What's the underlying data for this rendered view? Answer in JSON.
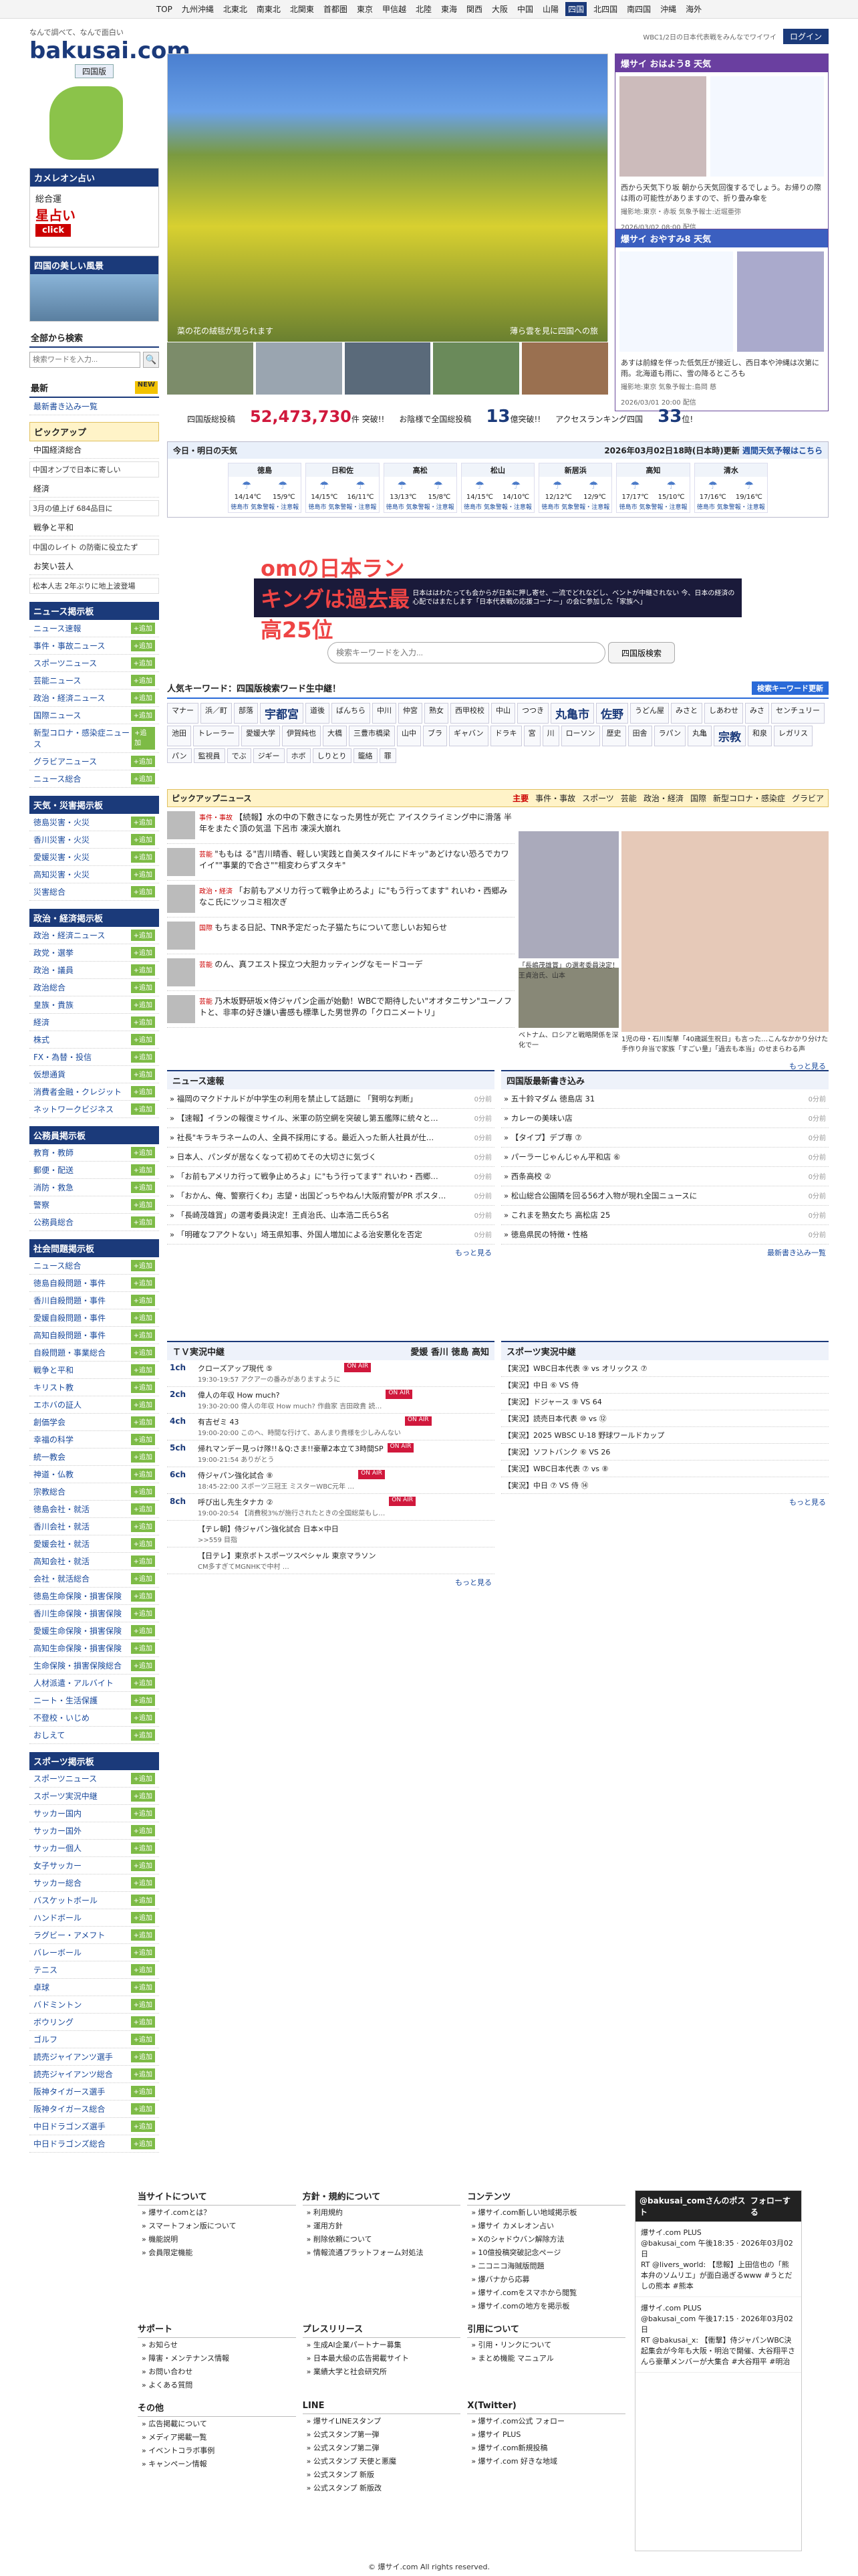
{
  "topnav": {
    "items": [
      "TOP",
      "九州沖縄",
      "北東北",
      "南東北",
      "北関東",
      "首都圏",
      "東京",
      "甲信越",
      "北陸",
      "東海",
      "関西",
      "大阪",
      "中国",
      "山陽",
      "四国",
      "北四国",
      "南四国",
      "沖縄",
      "海外"
    ],
    "active": "四国"
  },
  "header": {
    "tagline": "なんで調べて、なんで面白い",
    "logo": "bakusai.com",
    "region": "四国版",
    "login": "ログイン",
    "note": "WBC1/2日の日本代表戦をみんなでワイワイ"
  },
  "left": {
    "uranai_title": "カメレオン占い",
    "uranai_sub": "総合運",
    "uranai_star": "星占い",
    "uranai_click": "click",
    "scene_title": "四国の美しい風景",
    "search_title": "全部から検索",
    "search_placeholder": "検索ワードを入力...",
    "newest": "最新",
    "newest_link": "最新書き込み一覧",
    "pickup": "ピックアップ",
    "pickup_items": [
      "中国経済総合",
      "中国オンブで日本に寄しい",
      "経済",
      "3月の値上げ 684品目に",
      "戦争と平和",
      "中国のレイト の防衛に役立たず",
      "お笑い芸人",
      "松本人志 2年ぶりに地上波登場"
    ],
    "news_title": "ニュース掲示板",
    "news_items": [
      "ニュース速報",
      "事件・事故ニュース",
      "スポーツニュース",
      "芸能ニュース",
      "政治・経済ニュース",
      "国際ニュース",
      "新型コロナ・感染症ニュース",
      "グラビアニュース",
      "ニュース総合"
    ],
    "weather_title": "天気・災害掲示板",
    "weather_items": [
      "徳島災害・火災",
      "香川災害・火災",
      "愛媛災害・火災",
      "高知災害・火災",
      "災害総合"
    ],
    "politics_title": "政治・経済掲示板",
    "politics_items": [
      "政治・経済ニュース",
      "政党・選挙",
      "政治・議員",
      "政治総合",
      "皇族・貴族",
      "経済",
      "株式",
      "FX・為替・投信",
      "仮想通貨",
      "消費者金融・クレジット",
      "ネットワークビジネス"
    ],
    "public_title": "公務員掲示板",
    "public_items": [
      "教育・教師",
      "郵便・配送",
      "消防・救急",
      "警察",
      "公務員総合"
    ],
    "social_title": "社会問題掲示板",
    "social_items": [
      "ニュース総合",
      "徳島自殺問題・事件",
      "香川自殺問題・事件",
      "愛媛自殺問題・事件",
      "高知自殺問題・事件",
      "自殺問題・事業総合",
      "戦争と平和",
      "キリスト教",
      "エホバの証人",
      "創価学会",
      "幸福の科学",
      "統一教会",
      "神道・仏教",
      "宗教総合",
      "徳島会社・就活",
      "香川会社・就活",
      "愛媛会社・就活",
      "高知会社・就活",
      "会社・就活総合",
      "徳島生命保険・損害保険",
      "香川生命保険・損害保険",
      "愛媛生命保険・損害保険",
      "高知生命保険・損害保険",
      "生命保険・損害保険総合",
      "人材派遣・アルバイト",
      "ニート・生活保護",
      "不登校・いじめ",
      "おしえて"
    ],
    "sports_title": "スポーツ掲示板",
    "sports_items": [
      "スポーツニュース",
      "スポーツ実況中継",
      "サッカー国内",
      "サッカー国外",
      "サッカー個人",
      "女子サッカー",
      "サッカー総合",
      "バスケットボール",
      "ハンドボール",
      "ラグビー・アメフト",
      "バレーボール",
      "テニス",
      "卓球",
      "バドミントン",
      "ボウリング",
      "ゴルフ",
      "読売ジャイアンツ選手",
      "読売ジャイアンツ総合",
      "阪神タイガース選手",
      "阪神タイガース総合",
      "中日ドラゴンズ選手",
      "中日ドラゴンズ総合"
    ],
    "add": "+追加"
  },
  "hero": {
    "caption": "菜の花の絨毯が見られます",
    "caption2": "薄ら雲を見に四国への旅"
  },
  "stats": {
    "label1": "四国版総投稿",
    "posts": "52,473,730",
    "unit1": "件",
    "suffix1": "突破!!",
    "label2": "お陰様で全国総投稿",
    "posts2": "13",
    "unit2": "億突破!!",
    "label3": "アクセスランキング四国",
    "rank": "33",
    "unit3": "位!"
  },
  "weather_boxes": [
    {
      "title": "爆サイ おはよう8 天気",
      "text": "西から天気下り坂 朝から天気回復するでしょう。お帰りの際は雨の可能性がありますので、折り畳み傘を",
      "meta": "撮影地:東京・赤坂 気象予報士:近堀亜弥",
      "date": "2026/03/02 08:00 配信"
    },
    {
      "title": "爆サイ おやすみ8 天気",
      "text": "あすは前線を伴った低気圧が接近し、西日本や沖縄は次第に雨。北海道も雨に、雪の降るところも",
      "meta": "撮影地:東京 気象予報士:島岡 慈",
      "date": "2026/03/01 20:00 配信"
    }
  ],
  "forecast": {
    "title": "今日・明日の天気",
    "updated": "2026年03月02日18時(日本時)更新",
    "link": "週間天気予報はこちら",
    "cities": [
      {
        "name": "徳島",
        "t1": "14/14℃",
        "t2": "15/9℃"
      },
      {
        "name": "日和佐",
        "t1": "14/15℃",
        "t2": "16/11℃"
      },
      {
        "name": "高松",
        "t1": "13/13℃",
        "t2": "15/8℃"
      },
      {
        "name": "松山",
        "t1": "14/15℃",
        "t2": "14/10℃"
      },
      {
        "name": "新居浜",
        "t1": "12/12℃",
        "t2": "12/9℃"
      },
      {
        "name": "高知",
        "t1": "17/17℃",
        "t2": "15/10℃"
      },
      {
        "name": "清水",
        "t1": "17/16℃",
        "t2": "19/16℃"
      }
    ],
    "today": "今日",
    "tomorrow": "明日",
    "alert": "徳島市 気象警報・注意報"
  },
  "banner": {
    "main": "omの日本ランキングは過去最高25位",
    "sub": "日本ははわたっても会からが日本に押し寄せ、一流でどれなどし、ベントが中継されない 今、日本の経済の心配ではまたします「日本代表戦の応援コーナー」の会に参加した「家族へ」"
  },
  "mainsearch": {
    "placeholder": "検索キーワードを入力...",
    "button": "四国版検索"
  },
  "keywords": {
    "title": "人気キーワード：四国版検索ワード生中継！",
    "button": "検索キーワード更新",
    "items": [
      "マナー",
      "浜／町",
      "部落",
      "宇都宮",
      "道後",
      "ばんちら",
      "中川",
      "仲宮",
      "熟女",
      "西甲校校",
      "中山",
      "つつき",
      "丸亀市",
      "佐野",
      "うどん屋",
      "みさと",
      "しあわせ",
      "みさ",
      "センチュリー",
      "池田",
      "トレーラー",
      "愛媛大学",
      "伊賀純也",
      "大橋",
      "三豊市橋梁",
      "山中",
      "ブラ",
      "ギャバン",
      "ドラキ",
      "宮",
      "川",
      "ローソン",
      "歴史",
      "田舎",
      "ラパン",
      "丸亀",
      "宗教",
      "和泉",
      "レガリス",
      "パン",
      "監視員",
      "でぶ",
      "ジギー",
      "ホボ",
      "しりとり",
      "籠絡",
      "罪"
    ]
  },
  "pickup_main": {
    "title": "ピックアップニュース",
    "tabs": [
      "主要",
      "事件・事故",
      "スポーツ",
      "芸能",
      "政治・経済",
      "国際",
      "新型コロナ・感染症",
      "グラビア"
    ],
    "items": [
      {
        "tag": "事件・事故",
        "text": "【続報】水の中の下敷きになった男性が死亡 アイスクライミング中に滑落 半年をまたぐ頂の気温 下呂市 凍渓大崩れ"
      },
      {
        "tag": "芸能",
        "text": "\"ももは る\"吉川晴香、軽しい実践と自美スタイルにドキッ\"あどけない恐ろでカワイイ\"\"事業的で合さ\"\"相変わらずスタキ\""
      },
      {
        "tag": "政治・経済",
        "text": "「お前もアメリカ行って戦争止めろよ」に\"もう行ってます\" れいわ・西郷みなこ氏にツッコミ相次ぎ"
      },
      {
        "tag": "国際",
        "text": "もちまる日記、TNR予定だった子猫たちについて悲しいお知らせ"
      },
      {
        "tag": "芸能",
        "text": "のん、真フエスト探立つ大胆カッティングなモードコーデ"
      },
      {
        "tag": "芸能",
        "text": "乃木坂野研坂×侍ジャパン企画が始動！WBCで期待したい\"オオタニサン\"ユーノフトと、非率の好き嫌い書感も標準した男世界の「クロニメートリ」"
      }
    ],
    "cap1": "「長嶋茂雄賞」の選考委員決定！王貞治氏、山本",
    "cap2": "ベトナム、ロシアと戦略関係を深化で一",
    "cap3": "1児の母・石川梨華「40歳誕生祝日」も言った…こんなかかり分けた手作り弁当で家族「すごい量」「過去も本当」のせまらわる声",
    "more": "もっと見る"
  },
  "news_cols": [
    {
      "title": "ニュース速報",
      "items": [
        {
          "t": "福岡のマクドナルドが中学生の利用を禁止して話題に 「賢明な判断」",
          "time": "0分前"
        },
        {
          "t": "【速報】イランの報復ミサイル、米軍の防空網を突破し第五艦隊に統々と…",
          "time": "0分前"
        },
        {
          "t": "社長\"キラキラネームの人、全員不採用にする。最近入った新人社員が仕…",
          "time": "0分前"
        },
        {
          "t": "日本人、パンダが居なくなって初めてその大切さに気づく",
          "time": "0分前"
        },
        {
          "t": "「お前もアメリカ行って戦争止めろよ」に\"もう行ってます\" れいわ・西郷…",
          "time": "0分前"
        },
        {
          "t": "「おかん、俺、警察行くわ」志望・出国どっちやねん!大阪府警がPR ポスタ…",
          "time": "0分前"
        },
        {
          "t": "「長崎茂雄賞」の選考委員決定！王貞治氏、山本浩二氏ら5名",
          "time": "0分前"
        },
        {
          "t": "「明確なフアクトない」埼玉県知事、外国人増加による治安悪化を否定",
          "time": "0分前"
        }
      ]
    },
    {
      "title": "四国版最新書き込み",
      "items": [
        {
          "t": "五十鈴マダム 徳島店 31",
          "time": "0分前"
        },
        {
          "t": "カレーの美味い店",
          "time": "0分前"
        },
        {
          "t": "【タイプ】デブ専 ⑦",
          "time": "0分前"
        },
        {
          "t": "パーラーじゃんじゃん平和店 ⑥",
          "time": "0分前"
        },
        {
          "t": "西条高校 ②",
          "time": "0分前"
        },
        {
          "t": "松山総合公園隣を回る56才入物が現れ全国ニュースに",
          "time": "0分前"
        },
        {
          "t": "これまを熟女たち 高松店 25",
          "time": "0分前"
        },
        {
          "t": "徳島県民の特徴・性格",
          "time": "0分前"
        }
      ]
    }
  ],
  "news_more": [
    "もっと見る",
    "最新書き込み一覧"
  ],
  "tv": {
    "title": "ＴＶ実況中継",
    "tabs": [
      "愛媛",
      "香川",
      "徳島",
      "高知"
    ],
    "items": [
      {
        "ch": "1ch",
        "name": "クローズアップ現代 ⑤",
        "sub": "19:30-19:57 アクアーの番みがありますように"
      },
      {
        "ch": "2ch",
        "name": "偉人の年収 How much?",
        "sub": "19:30-20:00 偉人の年収 How much? 作曲家 吉田政貴 読…"
      },
      {
        "ch": "4ch",
        "name": "有吉ゼミ 43",
        "sub": "19:00-20:00 このへ、時間な行けて、あんまり貴様を少しみんない"
      },
      {
        "ch": "5ch",
        "name": "帰れマンデー見っけ隊!!＆Q:さま!!豪華2本立て3時間SP",
        "sub": "19:00-21:54 ありがとう"
      },
      {
        "ch": "6ch",
        "name": "侍ジャパン強化試合 ⑧",
        "sub": "18:45-22:00 スポーツ三冠王 ミスターWBC元年 …"
      },
      {
        "ch": "8ch",
        "name": "呼び出し先生タナカ ②",
        "sub": "19:00-20:54 【消費税3%が施行されたときの全国総菜もし…"
      },
      {
        "ch": "",
        "name": "【テレ朝】侍ジャパン強化試合 日本×中日",
        "sub": ">>559 目指"
      },
      {
        "ch": "",
        "name": "【日テレ】東京ボトスポーツスペシャル 東京マラソン",
        "sub": "CM多すぎてMGNHKで中村 …"
      }
    ],
    "onair": "ON AIR",
    "more": "もっと見る"
  },
  "sportslive": {
    "title": "スポーツ実況中継",
    "items": [
      "【実況】WBC日本代表 ⑨ vs オリックス ⑦",
      "【実況】中日 ⑥ VS 侍",
      "【実況】ドジャース ⑨ VS 64",
      "【実況】読売日本代表 ⑩ vs ⑫",
      "【実況】2025 WBSC U-18 野球ワールドカップ",
      "【実況】ソフトバンク ⑥ VS 26",
      "【実況】WBC日本代表 ⑦ vs ⑧",
      "【実況】中日 ⑦ VS 侍 ⑭"
    ],
    "more": "もっと見る"
  },
  "footer": {
    "groups": [
      {
        "title": "当サイトについて",
        "items": [
          "爆サイ.comとは？",
          "スマートフォン版について",
          "機能説明",
          "会員限定機能"
        ]
      },
      {
        "title": "方針・規約について",
        "items": [
          "利用規約",
          "運用方針",
          "削除依頼について",
          "情報流通プラットフォーム対処法"
        ]
      },
      {
        "title": "コンテンツ",
        "items": [
          "爆サイ.com新しい地域掲示板",
          "爆サイ カメレオン占い",
          "Xのシャドウバン解除方法",
          "10億投稿突破記念ページ",
          "二コニコ海賊版問題",
          "爆バナから応募",
          "爆サイ.comをスマホから閲覧",
          "爆サイ.comの地方を掲示板"
        ]
      },
      {
        "title": "サポート",
        "items": [
          "お知らせ",
          "障害・メンテナンス情報",
          "お問い合わせ",
          "よくある質問"
        ]
      },
      {
        "title": "プレスリリース",
        "items": [
          "生成AI企業パートナー募集",
          "日本最大級の広告掲載サイト",
          "業績大学と社会研究所"
        ]
      },
      {
        "title": "引用について",
        "items": [
          "引用・リンクについて",
          "まとめ機能 マニュアル"
        ]
      },
      {
        "title": "その他",
        "items": [
          "広告掲載について",
          "メディア掲載一覧",
          "イベントコラボ事例",
          "キャンペーン情報"
        ]
      },
      {
        "title": "LINE",
        "items": [
          "爆サイLINEスタンプ",
          "公式スタンプ第一弾",
          "公式スタンプ第二弾",
          "公式スタンプ 天使と悪魔",
          "公式スタンプ 新版",
          "公式スタンプ 新版改"
        ]
      },
      {
        "title": "X(Twitter)",
        "items": [
          "爆サイ.com公式 フォロー",
          "爆サイ PLUS",
          "爆サイ.com新規投稿",
          "爆サイ.com 好きな地域"
        ]
      }
    ],
    "copyright": "© 爆サイ.com All rights reserved."
  },
  "xtimeline": {
    "title": "@bakusai_comさんのポスト",
    "follow": "フォローする",
    "posts": [
      {
        "name": "爆サイ.com PLUS",
        "handle": "@bakusai_com 午後18:35 · 2026年03月02日",
        "text": "RT @livers_world: 【悲報】上田信也の「熊本弁のソムリエ」が面白過ぎるwww #うとだしの熊本 #熊本"
      },
      {
        "name": "爆サイ.com PLUS",
        "handle": "@bakusai_com 午後17:15 · 2026年03月02日",
        "text": "RT @bakusai_x: 【衝撃】侍ジャパンWBC決起集会が今年も大阪・明治で開催、大谷翔平さんら豪華メンバーが大集合 #大谷翔平 #明治"
      }
    ]
  },
  "colors": {
    "brand": "#1b3a7a",
    "accent": "#d0183c"
  }
}
